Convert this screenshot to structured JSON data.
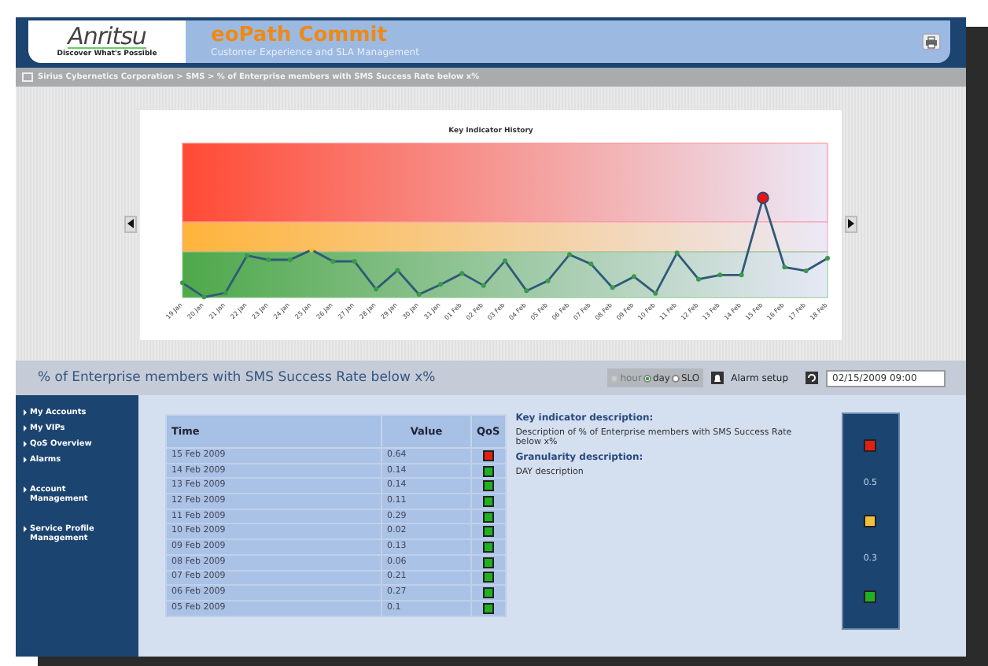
{
  "header": {
    "logo": "Anritsu",
    "tagline": "Discover What's Possible",
    "title": "eoPath Commit",
    "subtitle": "Customer Experience and SLA Management"
  },
  "breadcrumb": "Sirius Cybernetics Corporation > SMS > % of Enterprise members with SMS Success Rate below x%",
  "chart": {
    "title": "Key Indicator History",
    "x_labels": [
      "19 Jan",
      "20 Jan",
      "21 Jan",
      "22 Jan",
      "23 Jan",
      "24 Jan",
      "25 Jan",
      "26 Jan",
      "27 Jan",
      "28 Jan",
      "29 Jan",
      "30 Jan",
      "31 Jan",
      "01 Feb",
      "02 Feb",
      "03 Feb",
      "04 Feb",
      "05 Feb",
      "06 Feb",
      "07 Feb",
      "08 Feb",
      "09 Feb",
      "10 Feb",
      "11 Feb",
      "12 Feb",
      "13 Feb",
      "14 Feb",
      "15 Feb",
      "16 Feb",
      "17 Feb",
      "18 Feb"
    ]
  },
  "indicator_title": "% of Enterprise members with SMS Success Rate below x%",
  "granularity": [
    {
      "label": "hour",
      "selected": false,
      "disabled": true
    },
    {
      "label": "day",
      "selected": true,
      "disabled": false
    },
    {
      "label": "SLO",
      "selected": false,
      "disabled": false
    }
  ],
  "alarm_setup": "Alarm setup",
  "date_field": {
    "value": "02/15/2009 09:00"
  },
  "sidebar": {
    "groups": [
      [
        {
          "label": "My Accounts"
        },
        {
          "label": "My VIPs"
        },
        {
          "label": "QoS Overview"
        },
        {
          "label": "Alarms"
        }
      ],
      [
        {
          "label": "Account Management"
        }
      ],
      [
        {
          "label": "Service Profile Management"
        }
      ]
    ]
  },
  "table": {
    "columns": [
      "Time",
      "Value",
      "QoS"
    ],
    "rows": [
      {
        "time": "15 Feb 2009",
        "value": "0.64",
        "color": "#e02010"
      },
      {
        "time": "14 Feb 2009",
        "value": "0.14",
        "color": "#20b020"
      },
      {
        "time": "13 Feb 2009",
        "value": "0.14",
        "color": "#20b020"
      },
      {
        "time": "12 Feb 2009",
        "value": "0.11",
        "color": "#20b020"
      },
      {
        "time": "11 Feb 2009",
        "value": "0.29",
        "color": "#20b020"
      },
      {
        "time": "10 Feb 2009",
        "value": "0.02",
        "color": "#20b020"
      },
      {
        "time": "09 Feb 2009",
        "value": "0.13",
        "color": "#20b020"
      },
      {
        "time": "08 Feb 2009",
        "value": "0.06",
        "color": "#20b020"
      },
      {
        "time": "07 Feb 2009",
        "value": "0.21",
        "color": "#20b020"
      },
      {
        "time": "06 Feb 2009",
        "value": "0.27",
        "color": "#20b020"
      },
      {
        "time": "05 Feb 2009",
        "value": "0.1",
        "color": "#20b020"
      }
    ]
  },
  "description": {
    "heading": "Key indicator description:",
    "text": "Description of % of Enterprise members with SMS Success Rate below x%",
    "granularity_heading": "Granularity description:",
    "granularity_text": "DAY description"
  },
  "legend": [
    {
      "kind": "swatch",
      "color": "#e02010"
    },
    {
      "kind": "threshold",
      "label": "0.5"
    },
    {
      "kind": "swatch",
      "color": "#f0c040"
    },
    {
      "kind": "threshold",
      "label": "0.3"
    },
    {
      "kind": "swatch",
      "color": "#20b020"
    }
  ]
}
